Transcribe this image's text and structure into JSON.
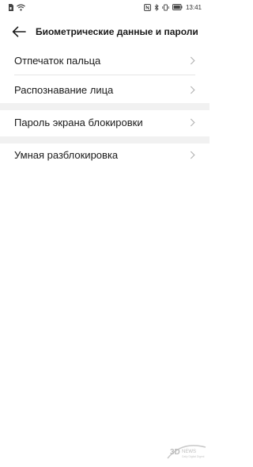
{
  "status": {
    "time": "13:41",
    "battery_percent": 100,
    "icons": [
      "sim-icon",
      "wifi-icon",
      "nfc-icon",
      "bluetooth-icon",
      "vibrate-icon",
      "battery-icon"
    ]
  },
  "header": {
    "title": "Биометрические данные и пароли"
  },
  "groups": [
    {
      "items": [
        {
          "label": "Отпечаток пальца"
        },
        {
          "label": "Распознавание лица"
        }
      ]
    },
    {
      "items": [
        {
          "label": "Пароль экрана блокировки"
        }
      ]
    },
    {
      "items": [
        {
          "label": "Умная разблокировка"
        }
      ]
    }
  ],
  "watermark": {
    "brand": "3DNews",
    "tagline": "Daily Digital Digest"
  },
  "colors": {
    "text": "#1a1a1a",
    "divider": "#e6e6e6",
    "section_gap": "#f1f1f1",
    "chevron": "#b5b5b5"
  }
}
